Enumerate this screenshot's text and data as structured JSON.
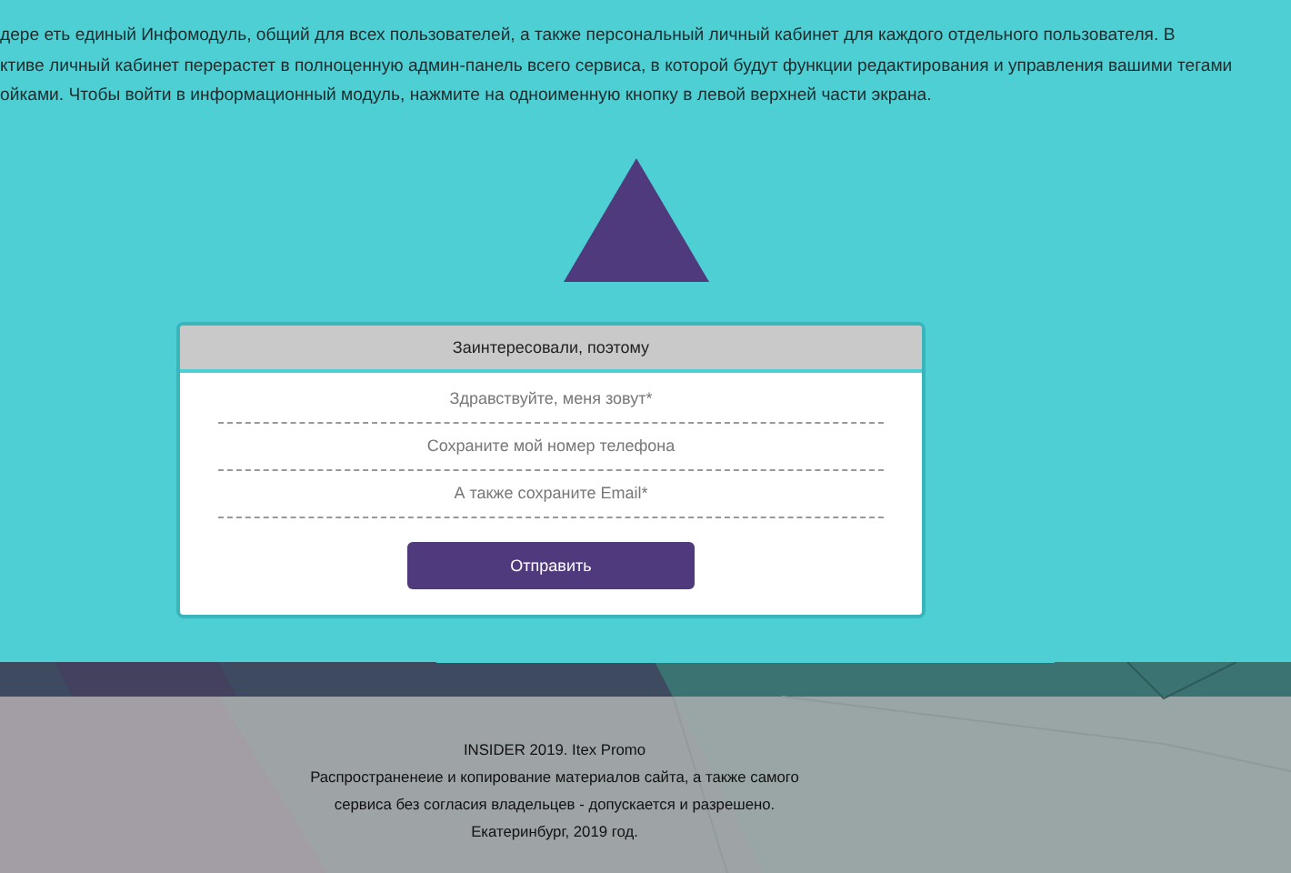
{
  "intro": [
    "дере еть единый Инфомодуль, общий для всех пользователей, а также персональный личный кабинет для каждого отдельного пользователя. В",
    "ктиве личный кабинет перерастет в полноценную админ-панель всего сервиса, в которой будут функции редактирования и управления вашими тегами",
    "ойками. Чтобы войти в информационный модуль, нажмите на одноименную кнопку в левой верхней части экрана."
  ],
  "form": {
    "title": "Заинтересовали, поэтому",
    "fields": [
      {
        "placeholder": "Здравствуйте, меня зовут*"
      },
      {
        "placeholder": "Сохраните мой номер телефона"
      },
      {
        "placeholder": "А также сохраните Email*"
      }
    ],
    "submit": "Отправить"
  },
  "footer": [
    "INSIDER 2019. Itex Promo",
    "Распространенеие и копирование материалов сайта, а также самого",
    "сервиса без согласия владельцев - допускается и разрешено.",
    "Екатеринбург, 2019 год."
  ]
}
